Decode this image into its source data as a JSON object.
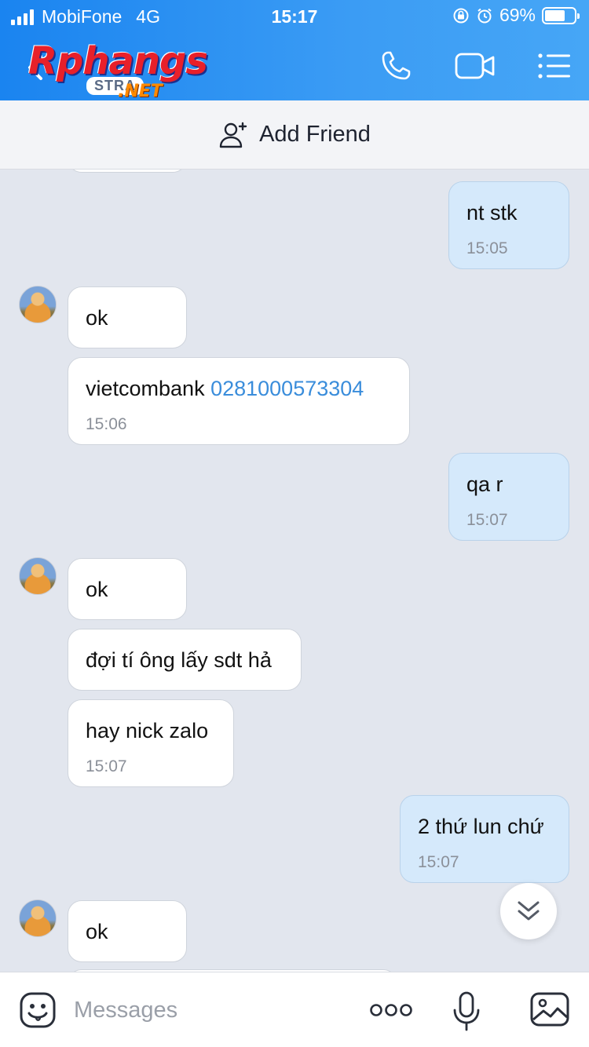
{
  "status_bar": {
    "carrier": "MobiFone",
    "network": "4G",
    "time": "15:17",
    "battery": "69%",
    "battery_level": 0.69
  },
  "header": {
    "logo_main": "Rphangs",
    "logo_sub": "STRA",
    "logo_net": ".NET"
  },
  "add_friend": {
    "label": "Add Friend"
  },
  "messages": [
    {
      "dir": "out",
      "text": "nt stk",
      "time": "15:05"
    },
    {
      "dir": "in",
      "text": "ok",
      "avatar": true
    },
    {
      "dir": "in",
      "text": "vietcombank ",
      "link": "0281000573304",
      "time": "15:06"
    },
    {
      "dir": "out",
      "text": "qa r",
      "time": "15:07"
    },
    {
      "dir": "in",
      "text": "ok",
      "avatar": true
    },
    {
      "dir": "in",
      "text": "đợi tí ông lấy sdt hả"
    },
    {
      "dir": "in",
      "text": "hay nick zalo",
      "time": "15:07"
    },
    {
      "dir": "out",
      "text": "2 thứ lun chứ",
      "time": "15:07"
    },
    {
      "dir": "in",
      "text": "ok",
      "avatar": true
    }
  ],
  "input": {
    "placeholder": "Messages"
  },
  "colors": {
    "header_start": "#1a84f0",
    "header_end": "#46a6f6",
    "chat_bg": "#e2e6ee",
    "outgoing_bubble": "#d5e9fb",
    "incoming_bubble": "#ffffff",
    "link": "#3a8ddb"
  }
}
